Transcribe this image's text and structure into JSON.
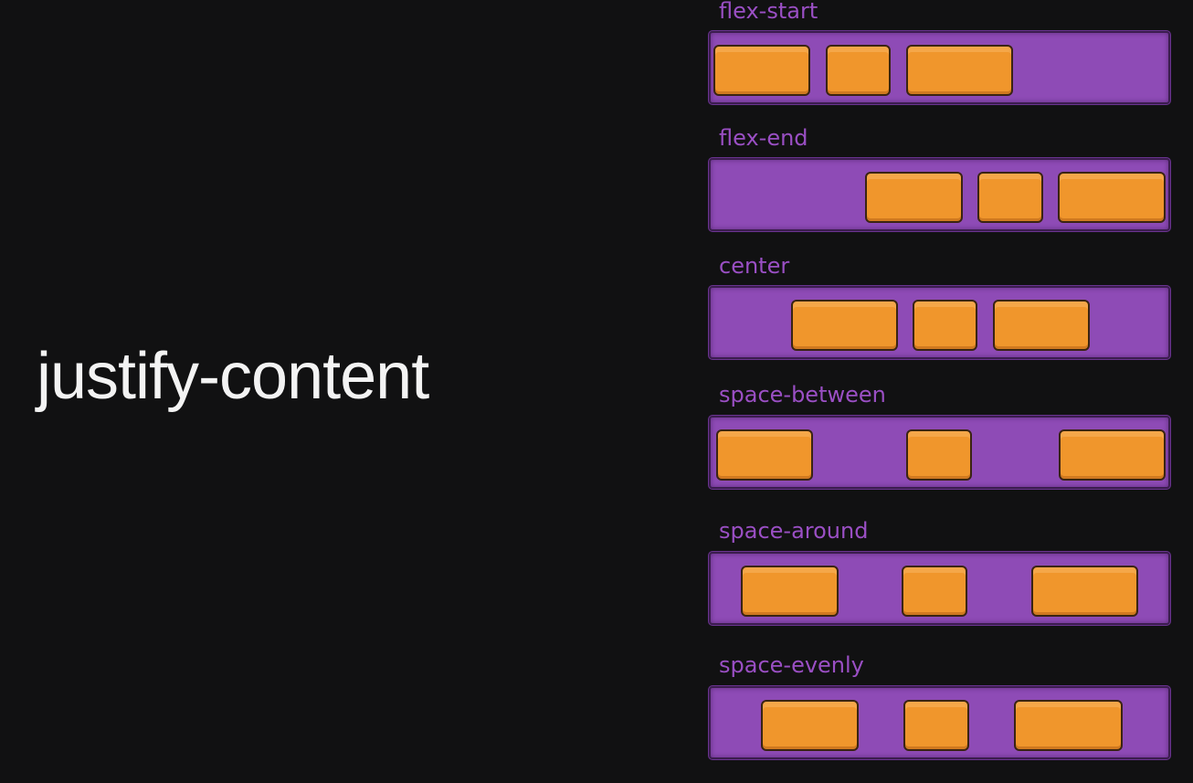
{
  "title": "justify-content",
  "colors": {
    "background": "#111112",
    "container": "#8e4bb6",
    "item": "#f0962c",
    "label": "#9a4fc4",
    "title_text": "#f3f3f3"
  },
  "demos": [
    {
      "label": "flex-start",
      "items": 3
    },
    {
      "label": "flex-end",
      "items": 3
    },
    {
      "label": "center",
      "items": 3
    },
    {
      "label": "space-between",
      "items": 3
    },
    {
      "label": "space-around",
      "items": 3
    },
    {
      "label": "space-evenly",
      "items": 3
    }
  ]
}
